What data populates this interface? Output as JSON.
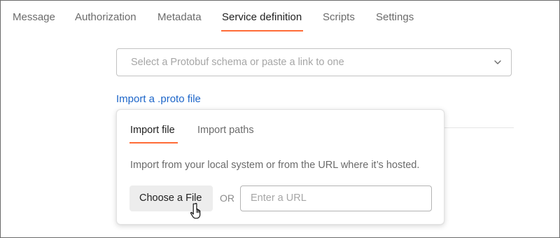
{
  "tabs": [
    {
      "label": "Message"
    },
    {
      "label": "Authorization"
    },
    {
      "label": "Metadata"
    },
    {
      "label": "Service definition",
      "active": true
    },
    {
      "label": "Scripts"
    },
    {
      "label": "Settings"
    }
  ],
  "schema_select": {
    "placeholder": "Select a Protobuf schema or paste a link to one",
    "icon": "chevron-down-icon"
  },
  "import_link": "Import a .proto file",
  "import_popover": {
    "tabs": [
      {
        "label": "Import file",
        "active": true
      },
      {
        "label": "Import paths"
      }
    ],
    "description": "Import from your local system or from the URL where it’s hosted.",
    "choose_file_label": "Choose a File",
    "or_label": "OR",
    "url_placeholder": "Enter a URL"
  },
  "colors": {
    "accent": "#ff6c37",
    "link": "#1d66c9"
  },
  "cursor_icon": "hand-pointer-icon"
}
